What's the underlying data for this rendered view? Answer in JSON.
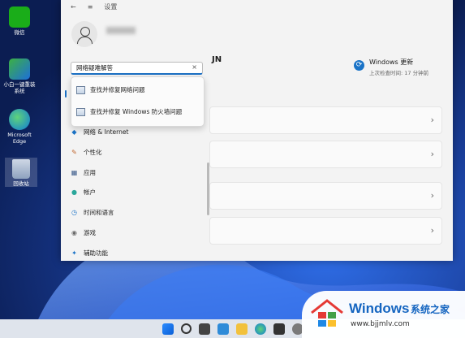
{
  "desktop": {
    "icons": [
      {
        "label": "微信",
        "icon": "wechat-icon"
      },
      {
        "label": "小白一键重装系统",
        "icon": "reinstall-icon"
      },
      {
        "label": "Microsoft Edge",
        "icon": "edge-icon"
      },
      {
        "label": "回收站",
        "icon": "recycle-bin-icon"
      }
    ]
  },
  "window": {
    "titlebar": {
      "back": "←",
      "menu": "≡",
      "title": "设置"
    },
    "pc_name": "JN",
    "update": {
      "title": "Windows 更新",
      "subtitle": "上次检查时间: 17 分钟前"
    },
    "search": {
      "value": "网络疑难解答",
      "clear": "×"
    },
    "suggestions": [
      "查找并修复网络问题",
      "查找并修复 Windows 防火墙问题"
    ],
    "nav": [
      {
        "label": "网络 & Internet",
        "icon": "wifi-icon",
        "glyph": "◆",
        "color": "#1a73c7"
      },
      {
        "label": "个性化",
        "icon": "brush-icon",
        "glyph": "✎",
        "color": "#c0662e"
      },
      {
        "label": "应用",
        "icon": "apps-icon",
        "glyph": "▦",
        "color": "#3a5a8a"
      },
      {
        "label": "帐户",
        "icon": "account-icon",
        "glyph": "●",
        "color": "#2aa79b"
      },
      {
        "label": "时间和语言",
        "icon": "clock-globe-icon",
        "glyph": "◷",
        "color": "#1a73c7"
      },
      {
        "label": "游戏",
        "icon": "gamepad-icon",
        "glyph": "◉",
        "color": "#6a6a6a"
      },
      {
        "label": "辅助功能",
        "icon": "accessibility-icon",
        "glyph": "✦",
        "color": "#1a73c7"
      }
    ],
    "card_chevron": "›"
  },
  "taskbar": {
    "icons": [
      "start-icon",
      "search-icon",
      "task-view-icon",
      "widgets-icon",
      "file-explorer-icon",
      "edge-icon",
      "store-icon",
      "settings-icon"
    ]
  },
  "watermark": {
    "brand": "Windows",
    "cn": "系统之家",
    "url": "www.bjjmlv.com"
  },
  "colors": {
    "accent": "#1a6fc4",
    "window_bg": "#f3f3f3",
    "watermark_blue": "#1565c0"
  }
}
